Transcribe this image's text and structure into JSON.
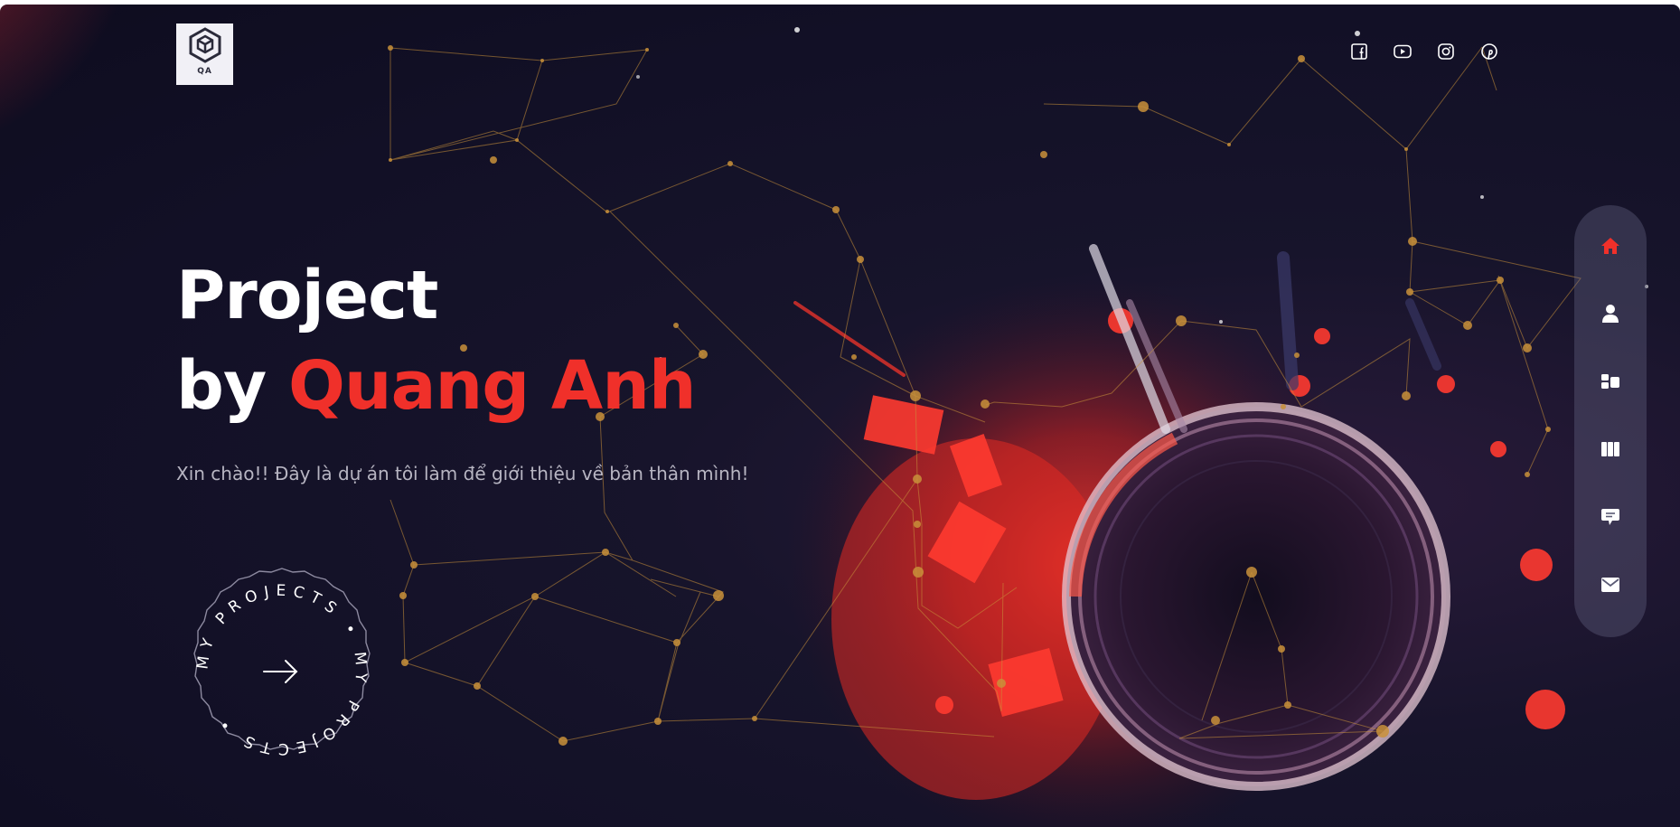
{
  "logo": {
    "text": "QA"
  },
  "hero": {
    "title_line1": "Project",
    "title_by": "by ",
    "title_name": "Quang Anh",
    "subtitle": "Xin chào!! Đây là dự án tôi làm để giới thiệu về bản thân mình!"
  },
  "social": [
    "facebook-icon",
    "youtube-icon",
    "instagram-icon",
    "pinterest-icon"
  ],
  "badge": {
    "text": "MY PROJECTS • MY PROJECTS •",
    "icon": "arrow-right-icon"
  },
  "side_nav": [
    {
      "icon": "home-icon",
      "active": true
    },
    {
      "icon": "user-icon",
      "active": false
    },
    {
      "icon": "services-icon",
      "active": false
    },
    {
      "icon": "portfolio-icon",
      "active": false
    },
    {
      "icon": "chat-icon",
      "active": false
    },
    {
      "icon": "mail-icon",
      "active": false
    }
  ],
  "colors": {
    "background": "#121026",
    "accent": "#f0302a",
    "text": "#ffffff",
    "muted": "#b7b5c2",
    "network": "#c9913a"
  }
}
